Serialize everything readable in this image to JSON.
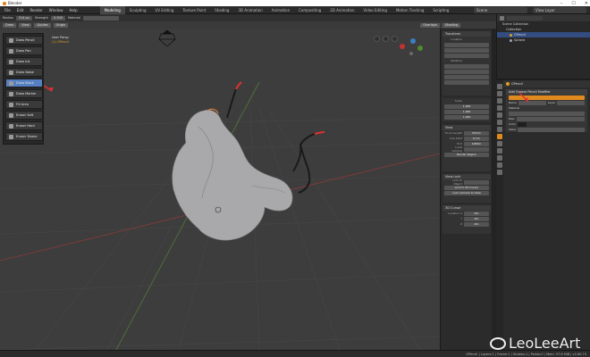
{
  "window": {
    "title": "Blender"
  },
  "menu": [
    "File",
    "Edit",
    "Render",
    "Window",
    "Help"
  ],
  "workspace_tabs": [
    "Modeling",
    "Sculpting",
    "UV Editing",
    "Texture Paint",
    "Shading",
    "3D Animation",
    "Animation",
    "Compositing",
    "2D Animation",
    "Video Editing",
    "Motion Tracking",
    "Scripting"
  ],
  "active_workspace": "Modeling",
  "scene_name": "Scene",
  "view_layer": "View Layer",
  "tool_header": {
    "radius_label": "Radius",
    "radius_value": "314 px",
    "strength_label": "Strength",
    "strength_value": "0.500",
    "material_label": "Material"
  },
  "viewport_header": {
    "mode": "Draw",
    "view": "View",
    "guides": "Guides",
    "origin": "Origin",
    "overlay_label": "Overlays",
    "shading": "Shading"
  },
  "viewport_overlay": {
    "line1": "User Persp",
    "line2": "(1) GPencil"
  },
  "tools": [
    {
      "label": "Draw Pencil",
      "active": false
    },
    {
      "label": "Draw Pen",
      "active": false
    },
    {
      "label": "Draw Ink",
      "active": false
    },
    {
      "label": "Draw Noise",
      "active": false
    },
    {
      "label": "Draw Block",
      "active": true
    },
    {
      "label": "Draw Marker",
      "active": false
    },
    {
      "label": "Fill Area",
      "active": false
    },
    {
      "label": "Eraser Soft",
      "active": false
    },
    {
      "label": "Eraser Hard",
      "active": false
    },
    {
      "label": "Eraser Stroke",
      "active": false
    }
  ],
  "npanel": {
    "transform_title": "Transform",
    "location_label": "Location",
    "rotation_label": "Rotation",
    "scale_label": "Scale",
    "scale_values": [
      "1.000",
      "1.000",
      "1.000"
    ],
    "view_title": "View",
    "focal_label": "Focal Length",
    "focal_value": "50mm",
    "clip_start_label": "Clip Start",
    "clip_start_value": "0.1m",
    "clip_end_label": "End",
    "clip_end_value": "1000m",
    "local_camera_label": "Local Camera",
    "render_region_label": "Render Region",
    "view_lock_title": "View Lock",
    "lock_object_label": "Lock to Object",
    "lock_3d_cursor_label": "Lock to 3D Cursor",
    "lock_camera_label": "Lock Camera to View",
    "cursor_title": "3D Cursor",
    "cursor_location_label": "Location X",
    "cursor_y_label": "Y",
    "cursor_z_label": "Z",
    "cursor_value": "0m"
  },
  "outliner": {
    "scene_collection": "Scene Collection",
    "collection": "Collection",
    "object1": "GPencil",
    "object2": "Sphere"
  },
  "properties": {
    "object_name": "GPencil",
    "add_modifier_label": "Add Grease Pencil Modifier",
    "name_label": "Name",
    "layer_label": "Layer",
    "material_label": "Material",
    "pass_label": "Pass",
    "color_label": "Color",
    "value_label": "Value"
  },
  "status": {
    "left": "",
    "stats": "GPencil | Layers:1 | Frame:1 | Strokes:1 | Points:0 | Mem: 57.6 MiB | v2.80.74"
  },
  "watermark": "LeoLeeArt",
  "colors": {
    "accent": "#e08a1e",
    "active_tool": "#5680c2",
    "stroke_red": "#e03030",
    "mesh_grey": "#a9a9ab"
  }
}
